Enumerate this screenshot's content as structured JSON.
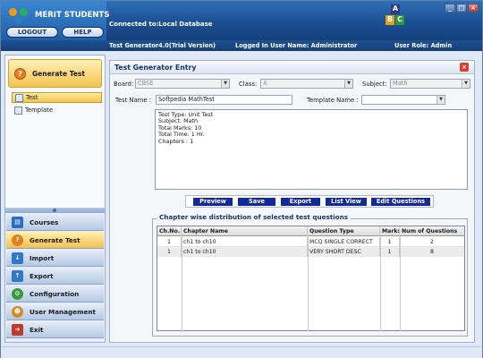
{
  "app": {
    "name": "MERIT STUDENTS",
    "logout_label": "LOGOUT",
    "help_label": "HELP",
    "connected_text": "Connected to:Local Database",
    "version_text": "Test Generator4.0(Trial Version)",
    "user_text": "Logged In User Name: Administrator",
    "role_text": "User Role: Admin",
    "abc_letters": [
      "A",
      "B",
      "C"
    ]
  },
  "sidebar": {
    "section_title": "Generate Test",
    "sub_items": [
      {
        "label": "Test",
        "icon": "test-page-icon",
        "selected": true
      },
      {
        "label": "Template",
        "icon": "template-icon",
        "selected": false
      }
    ],
    "nav_items": [
      {
        "label": "Courses",
        "icon": "courses-icon",
        "color": "#2b6cc4"
      },
      {
        "label": "Generate Test",
        "icon": "question-icon",
        "color": "#e67e22",
        "active": true
      },
      {
        "label": "Import",
        "icon": "import-icon",
        "color": "#2f79c8"
      },
      {
        "label": "Export",
        "icon": "export-icon",
        "color": "#2f79c8"
      },
      {
        "label": "Configuration",
        "icon": "configuration-icon",
        "color": "#3a9a3a"
      },
      {
        "label": "User Management",
        "icon": "users-icon",
        "color": "#d78a1d"
      },
      {
        "label": "Exit",
        "icon": "exit-icon",
        "color": "#c0392b"
      }
    ]
  },
  "main": {
    "title": "Test Generator Entry",
    "board_label": "Board:",
    "board_value": "CBSE",
    "class_label": "Class:",
    "class_value": "X",
    "subject_label": "Subject:",
    "subject_value": "Math",
    "test_name_label": "Test Name :",
    "test_name_value": "Softpedia MathTest",
    "template_name_label": "Template Name :",
    "template_name_value": "",
    "summary_lines": [
      "Test Type: Unit Test",
      "Subject: Math",
      "Total Marks: 10",
      "Total Time: 1 Hr.",
      "Chapters : 1"
    ],
    "actions": {
      "preview": "Preview",
      "save": "Save",
      "export": "Export",
      "list_view": "List View",
      "edit_questions": "Edit Questions"
    },
    "distribution": {
      "legend": "Chapter wise distribution of selected test questions",
      "columns": [
        "Ch.No.",
        "Chapter Name",
        "Question Type",
        "Marks",
        "Num of Questions"
      ],
      "rows": [
        [
          "1",
          "ch1 to ch10",
          "MCQ SINGLE CORRECT",
          "1",
          "2"
        ],
        [
          "1",
          "ch1 to ch10",
          "VERY SHORT DESC",
          "1",
          "8"
        ]
      ]
    }
  },
  "colors": {
    "header_blue": "#1b4f93",
    "accent_yellow": "#f3c34e",
    "action_button": "#13299a",
    "close_red": "#d9402c"
  }
}
